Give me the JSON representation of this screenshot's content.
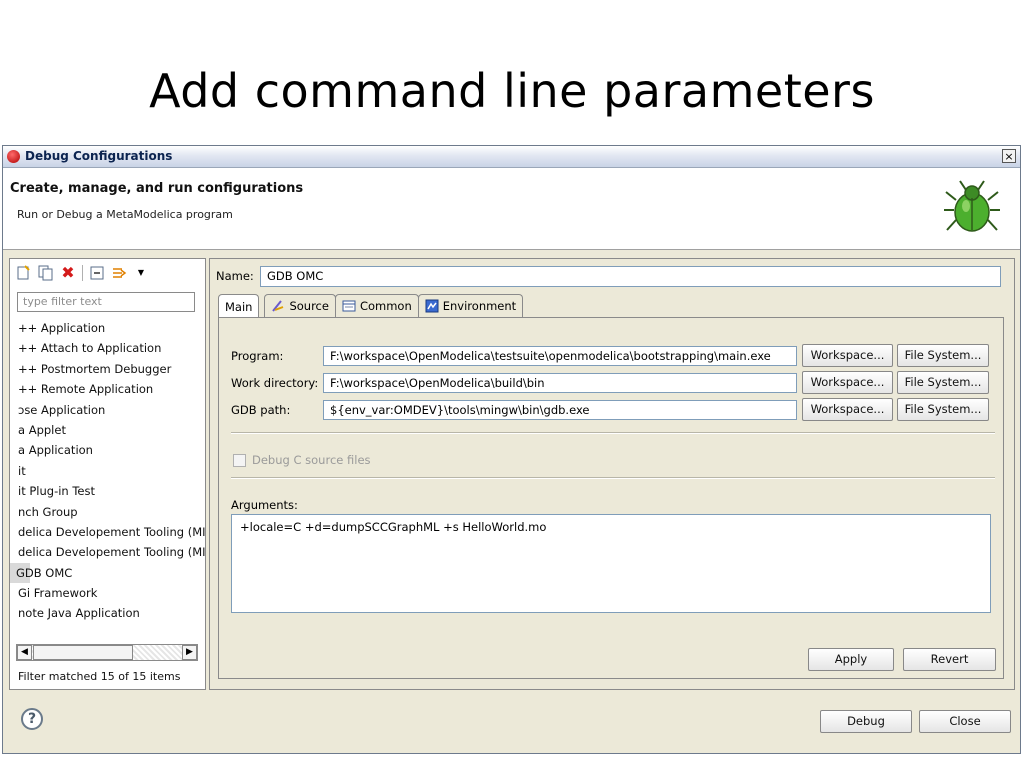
{
  "slide": {
    "title": "Add command line parameters"
  },
  "window": {
    "title": "Debug Configurations",
    "close_label": "×"
  },
  "header": {
    "title": "Create, manage, and run configurations",
    "subtitle": "Run or Debug a MetaModelica program",
    "logo_icon": "bug-icon"
  },
  "left": {
    "toolbar_icons": [
      "new-config-icon",
      "duplicate-icon",
      "delete-icon",
      "collapse-all-icon",
      "filter-icon",
      "dropdown-icon"
    ],
    "filter_placeholder": "type filter text",
    "items": [
      {
        "label": "++ Application"
      },
      {
        "label": "++ Attach to Application"
      },
      {
        "label": "++ Postmortem Debugger"
      },
      {
        "label": "++ Remote Application"
      },
      {
        "label": "ɔse Application"
      },
      {
        "label": "a Applet"
      },
      {
        "label": "a Application"
      },
      {
        "label": "it"
      },
      {
        "label": "it Plug-in Test"
      },
      {
        "label": "nch Group"
      },
      {
        "label": "delica Developement Tooling (MI"
      },
      {
        "label": "delica Developement Tooling (MI"
      },
      {
        "label": "GDB OMC",
        "selected": true
      },
      {
        "label": "Gi Framework"
      },
      {
        "label": "note Java Application"
      }
    ],
    "status": "Filter matched 15 of 15 items"
  },
  "config": {
    "name_label": "Name:",
    "name_value": "GDB OMC",
    "tabs": [
      {
        "label": "Main",
        "icon": null
      },
      {
        "label": "Source",
        "icon": "source-icon"
      },
      {
        "label": "Common",
        "icon": "common-icon"
      },
      {
        "label": "Environment",
        "icon": "environment-icon"
      }
    ],
    "program_label": "Program:",
    "program_value": "F:\\workspace\\OpenModelica\\testsuite\\openmodelica\\bootstrapping\\main.exe",
    "workdir_label": "Work directory:",
    "workdir_value": "F:\\workspace\\OpenModelica\\build\\bin",
    "gdb_label": "GDB path:",
    "gdb_value": "${env_var:OMDEV}\\tools\\mingw\\bin\\gdb.exe",
    "workspace_btn": "Workspace...",
    "filesystem_btn": "File System...",
    "debug_c_label": "Debug C source files",
    "arguments_label": "Arguments:",
    "arguments_value": "+locale=C +d=dumpSCCGraphML +s HelloWorld.mo"
  },
  "buttons": {
    "apply": "Apply",
    "revert": "Revert",
    "debug": "Debug",
    "close": "Close",
    "help": "?"
  }
}
